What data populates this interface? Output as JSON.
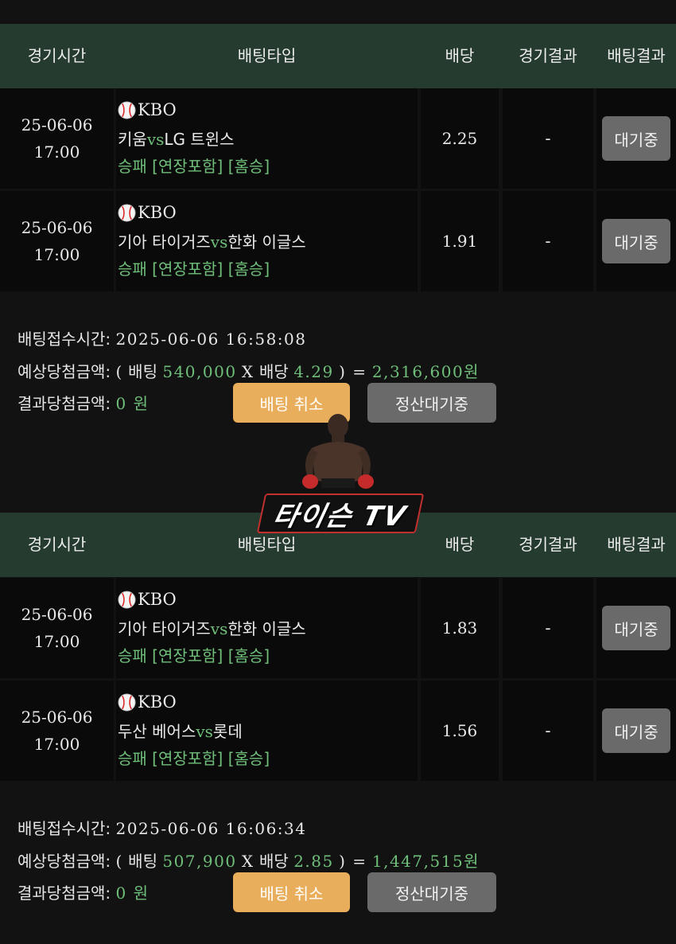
{
  "table_header": {
    "time": "경기시간",
    "bet_type": "배팅타입",
    "odds": "배당",
    "game_result": "경기결과",
    "bet_result": "배팅결과"
  },
  "slips": [
    {
      "rows": [
        {
          "date": "25-06-06",
          "time": "17:00",
          "league": "KBO",
          "home": "키움",
          "vs": "vs",
          "away": "LG 트윈스",
          "pick": "승패 [연장포함] [홈승]",
          "odds": "2.25",
          "result": "-",
          "status": "대기중"
        },
        {
          "date": "25-06-06",
          "time": "17:00",
          "league": "KBO",
          "home": "기아 타이거즈",
          "vs": "vs",
          "away": "한화 이글스",
          "pick": "승패 [연장포함] [홈승]",
          "odds": "1.91",
          "result": "-",
          "status": "대기중"
        }
      ],
      "accept_label": "배팅접수시간:",
      "accept_time": "2025-06-06 16:58:08",
      "expected_label": "예상당첨금액:",
      "open_paren": "(",
      "bet_word": "배팅",
      "bet_amount": "540,000",
      "times": "X",
      "odds_word": "배당",
      "total_odds": "4.29",
      "close_eq": ") =",
      "expected_amount": "2,316,600원",
      "win_label": "결과당첨금액:",
      "win_amount": "0 원",
      "cancel_label": "배팅 취소",
      "settle_label": "정산대기중"
    },
    {
      "rows": [
        {
          "date": "25-06-06",
          "time": "17:00",
          "league": "KBO",
          "home": "기아 타이거즈",
          "vs": "vs",
          "away": "한화 이글스",
          "pick": "승패 [연장포함] [홈승]",
          "odds": "1.83",
          "result": "-",
          "status": "대기중"
        },
        {
          "date": "25-06-06",
          "time": "17:00",
          "league": "KBO",
          "home": "두산 베어스",
          "vs": "vs",
          "away": "롯데",
          "pick": "승패 [연장포함] [홈승]",
          "odds": "1.56",
          "result": "-",
          "status": "대기중"
        }
      ],
      "accept_label": "배팅접수시간:",
      "accept_time": "2025-06-06 16:06:34",
      "expected_label": "예상당첨금액:",
      "open_paren": "(",
      "bet_word": "배팅",
      "bet_amount": "507,900",
      "times": "X",
      "odds_word": "배당",
      "total_odds": "2.85",
      "close_eq": ") =",
      "expected_amount": "1,447,515원",
      "win_label": "결과당첨금액:",
      "win_amount": "0 원",
      "cancel_label": "배팅 취소",
      "settle_label": "정산대기중"
    }
  ],
  "watermark": {
    "text": "타이슨 TV",
    "icon": "boxer-figure-icon"
  },
  "colors": {
    "header_bg": "#263b2f",
    "accent_green": "#6fbf7a",
    "cancel_button": "#e8ae5c",
    "wait_button": "#6a6a6a"
  }
}
